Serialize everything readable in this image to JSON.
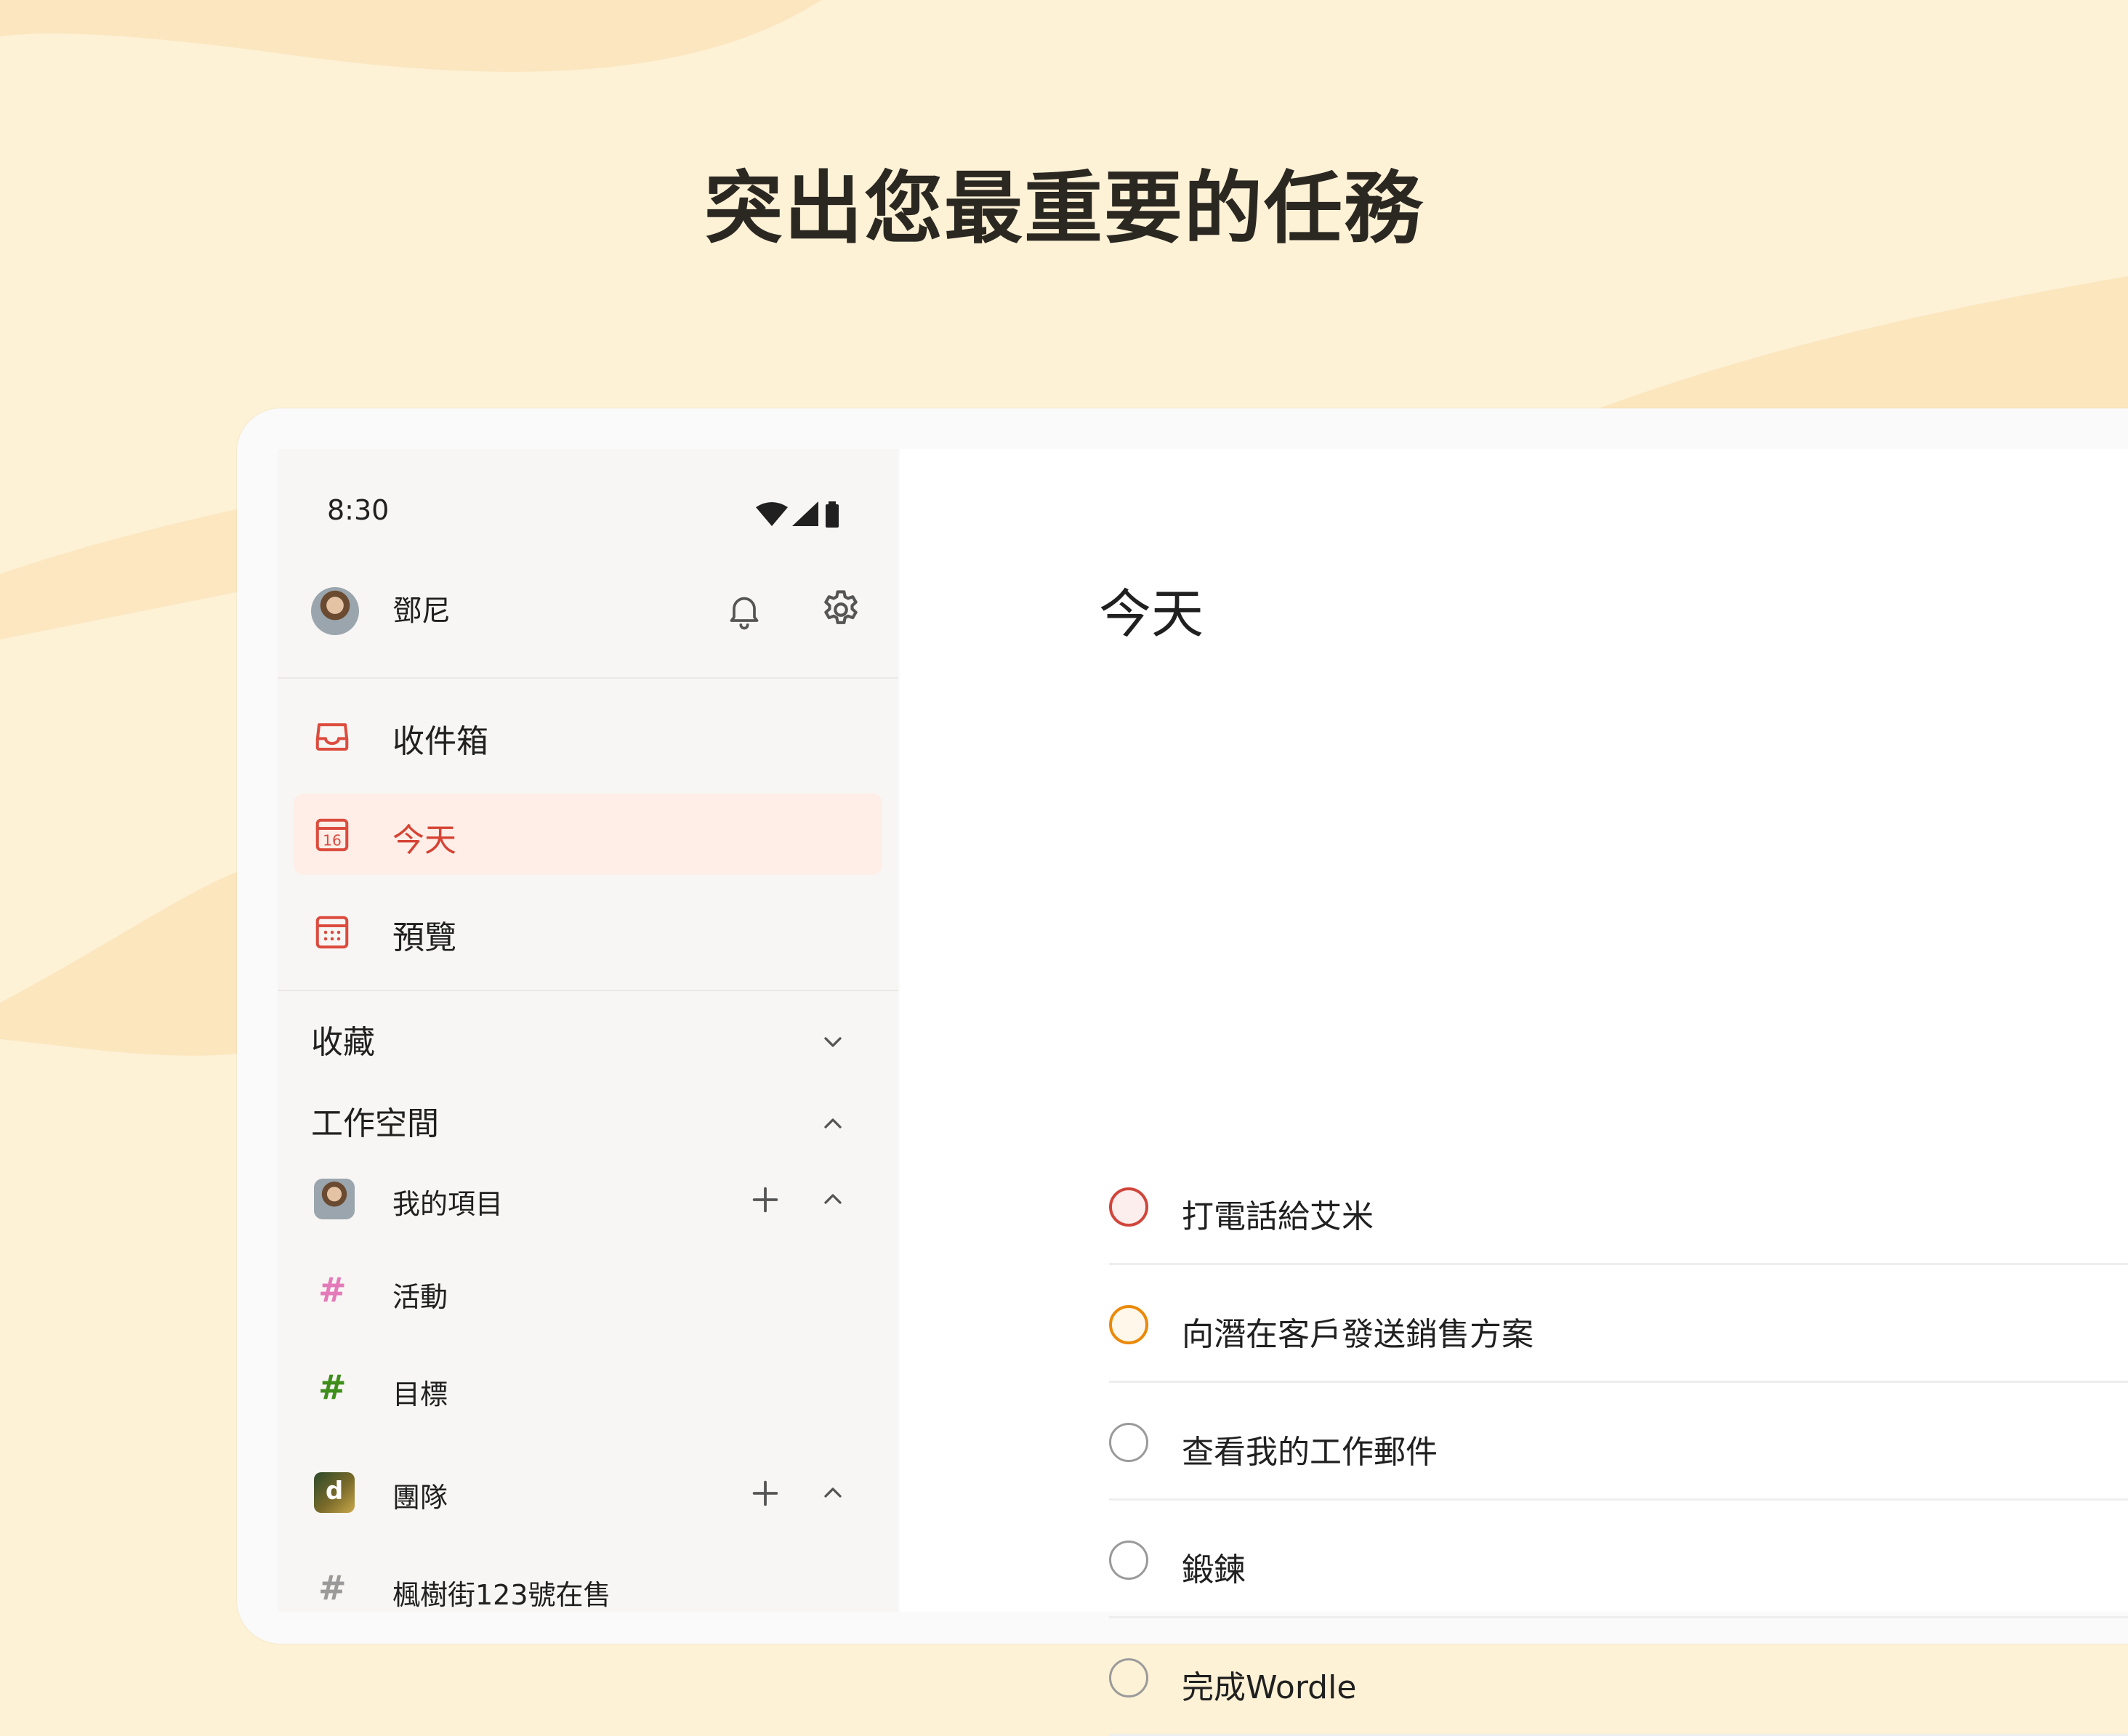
{
  "headline": "突出您最重要的任務",
  "status_bar": {
    "time": "8:30"
  },
  "user": {
    "name": "鄧尼"
  },
  "nav": [
    {
      "label": "收件箱",
      "icon": "inbox-icon"
    },
    {
      "label": "今天",
      "icon": "calendar-today-icon",
      "day": "16",
      "active": true
    },
    {
      "label": "預覽",
      "icon": "calendar-upcoming-icon"
    }
  ],
  "sections": {
    "favorites": "收藏",
    "workspace": "工作空間"
  },
  "projects": {
    "mine": {
      "label": "我的項目"
    },
    "items": [
      {
        "label": "活動",
        "hash": "#",
        "color": "#e47ab9"
      },
      {
        "label": "目標",
        "hash": "#",
        "color": "#3f8e1c"
      }
    ],
    "team": {
      "label": "團隊",
      "logo": "d"
    },
    "team_items": [
      {
        "label": "楓樹街123號在售",
        "hash": "#",
        "color": "#9a9a9a"
      }
    ]
  },
  "main": {
    "title": "今天",
    "tasks": [
      {
        "text": "打電話給艾米",
        "priority_color": "#d1453b"
      },
      {
        "text": "向潛在客戶發送銷售方案",
        "priority_color": "#eb8909"
      },
      {
        "text": "查看我的工作郵件",
        "priority_color": "#9a9a9a"
      },
      {
        "text": "鍛鍊",
        "priority_color": "#9a9a9a"
      },
      {
        "text": "完成Wordle",
        "priority_color": "#9a9a9a"
      }
    ]
  },
  "colors": {
    "accent": "#dc4c3e",
    "active_bg": "#feeee7",
    "background": "#fdf1d6"
  }
}
